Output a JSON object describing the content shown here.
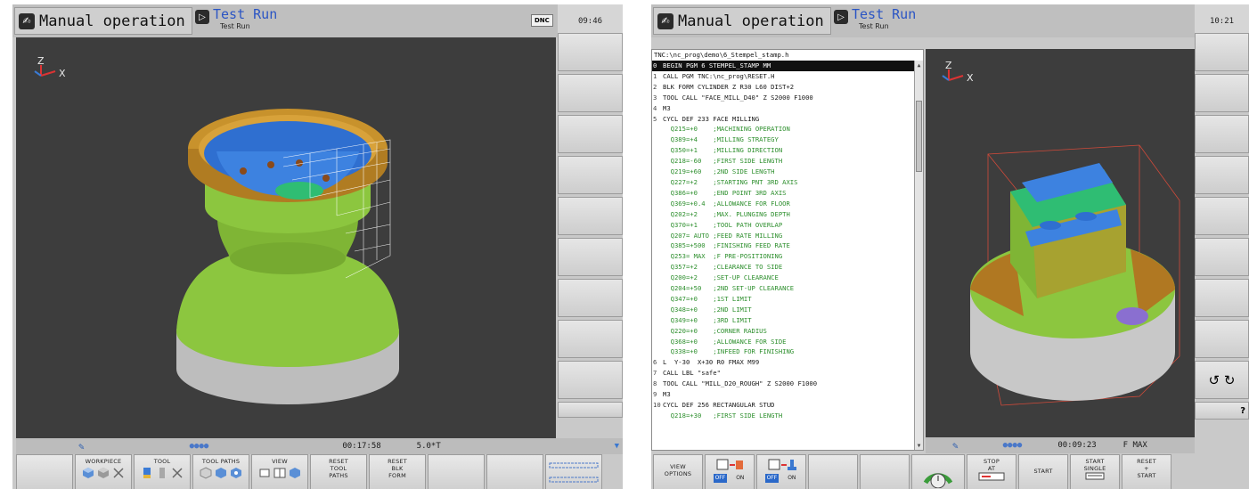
{
  "left": {
    "mode_label": "Manual operation",
    "sub_title": "Test Run",
    "sub_small": "Test Run",
    "dnc_label": "DNC",
    "clock": "09:46",
    "axis_z": "Z",
    "axis_x": "X",
    "status": {
      "dots": "●●●●",
      "time": "00:17:58",
      "angle": "5.0*T"
    },
    "softkeys": [
      {
        "label": ""
      },
      {
        "label": "WORKPIECE"
      },
      {
        "label": "TOOL"
      },
      {
        "label": "TOOL PATHS"
      },
      {
        "label": "VIEW"
      },
      {
        "label": "RESET\nTOOL\nPATHS"
      },
      {
        "label": "RESET\nBLK\nFORM"
      },
      {
        "label": ""
      },
      {
        "label": ""
      }
    ]
  },
  "right": {
    "mode_label": "Manual operation",
    "sub_title": "Test Run",
    "sub_small": "Test Run",
    "clock": "10:21",
    "path": "TNC:\\nc_prog\\demo\\6_Stempel_stamp.h",
    "axis_z": "Z",
    "axis_x": "X",
    "status": {
      "dots": "●●●●",
      "time": "00:09:23",
      "feed": "F MAX"
    },
    "rotate_icons": "↺ ↻",
    "question": "?",
    "program": [
      {
        "n": "0",
        "t": "BEGIN PGM 6 STEMPEL_STAMP MM"
      },
      {
        "n": "1",
        "t": "CALL PGM TNC:\\nc_prog\\RESET.H"
      },
      {
        "n": "2",
        "t": "BLK FORM CYLINDER Z R30 L60 DIST+2"
      },
      {
        "n": "3",
        "t": "TOOL CALL \"FACE_MILL_D40\" Z S2000 F1000"
      },
      {
        "n": "4",
        "t": "M3"
      },
      {
        "n": "5",
        "t": "CYCL DEF 233 FACE MILLING"
      },
      {
        "n": "",
        "t": "  Q215=+0    ;MACHINING OPERATION"
      },
      {
        "n": "",
        "t": "  Q389=+4    ;MILLING STRATEGY"
      },
      {
        "n": "",
        "t": "  Q350=+1    ;MILLING DIRECTION"
      },
      {
        "n": "",
        "t": "  Q218=-60   ;FIRST SIDE LENGTH"
      },
      {
        "n": "",
        "t": "  Q219=+60   ;2ND SIDE LENGTH"
      },
      {
        "n": "",
        "t": "  Q227=+2    ;STARTING PNT 3RD AXIS"
      },
      {
        "n": "",
        "t": "  Q386=+0    ;END POINT 3RD AXIS"
      },
      {
        "n": "",
        "t": "  Q369=+0.4  ;ALLOWANCE FOR FLOOR"
      },
      {
        "n": "",
        "t": "  Q202=+2    ;MAX. PLUNGING DEPTH"
      },
      {
        "n": "",
        "t": "  Q370=+1    ;TOOL PATH OVERLAP"
      },
      {
        "n": "",
        "t": "  Q207= AUTO ;FEED RATE MILLING"
      },
      {
        "n": "",
        "t": "  Q385=+500  ;FINISHING FEED RATE"
      },
      {
        "n": "",
        "t": "  Q253= MAX  ;F PRE-POSITIONING"
      },
      {
        "n": "",
        "t": "  Q357=+2    ;CLEARANCE TO SIDE"
      },
      {
        "n": "",
        "t": "  Q200=+2    ;SET-UP CLEARANCE"
      },
      {
        "n": "",
        "t": "  Q204=+50   ;2ND SET-UP CLEARANCE"
      },
      {
        "n": "",
        "t": "  Q347=+0    ;1ST LIMIT"
      },
      {
        "n": "",
        "t": "  Q348=+0    ;2ND LIMIT"
      },
      {
        "n": "",
        "t": "  Q349=+0    ;3RD LIMIT"
      },
      {
        "n": "",
        "t": "  Q220=+0    ;CORNER RADIUS"
      },
      {
        "n": "",
        "t": "  Q368=+0    ;ALLOWANCE FOR SIDE"
      },
      {
        "n": "",
        "t": "  Q338=+0    ;INFEED FOR FINISHING"
      },
      {
        "n": "6",
        "t": "L  Y-30  X+30 R0 FMAX M99"
      },
      {
        "n": "7",
        "t": "CALL LBL \"safe\""
      },
      {
        "n": "8",
        "t": "TOOL CALL \"MILL_D20_ROUGH\" Z S2000 F1000"
      },
      {
        "n": "9",
        "t": "M3"
      },
      {
        "n": "10",
        "t": "CYCL DEF 256 RECTANGULAR STUD"
      },
      {
        "n": "",
        "t": "  Q218=+30   ;FIRST SIDE LENGTH"
      }
    ],
    "softkeys": [
      {
        "label": "VIEW\nOPTIONS"
      },
      {
        "label": "",
        "off": "OFF",
        "on": "ON"
      },
      {
        "label": "",
        "off": "OFF",
        "on": "ON"
      },
      {
        "label": ""
      },
      {
        "label": ""
      },
      {
        "label": ""
      },
      {
        "label": "STOP\nAT"
      },
      {
        "label": "START"
      },
      {
        "label": "START\nSINGLE"
      },
      {
        "label": "RESET\n+\nSTART"
      }
    ]
  }
}
